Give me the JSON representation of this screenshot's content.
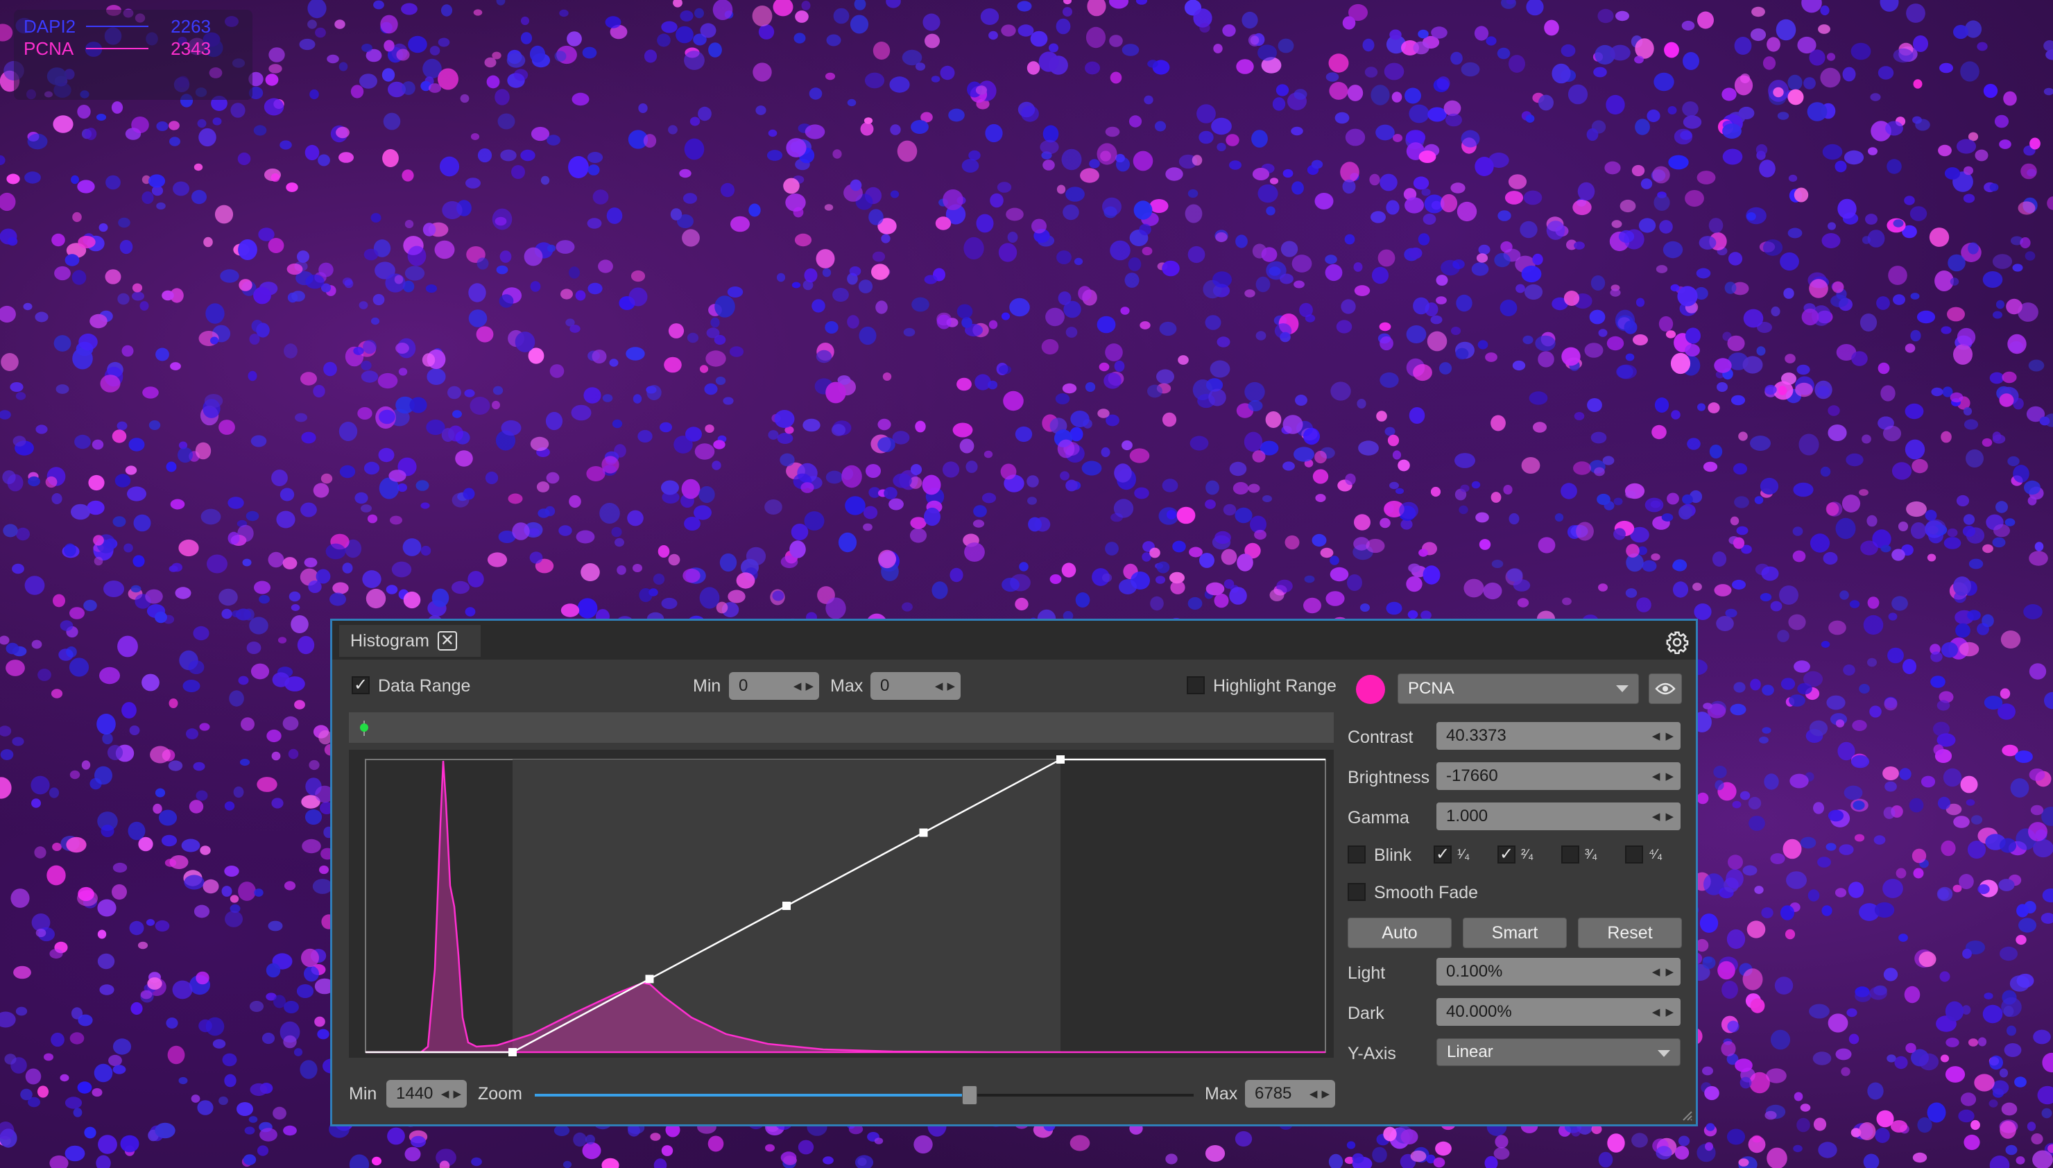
{
  "legend": {
    "channels": [
      {
        "name": "DAPI2",
        "value": "2263",
        "color": "#3b3bff"
      },
      {
        "name": "PCNA",
        "value": "2343",
        "color": "#ff2fd0"
      }
    ]
  },
  "panel": {
    "tab_label": "Histogram",
    "close_glyph": "✕",
    "data_range": {
      "label": "Data Range",
      "checked": true
    },
    "min_label": "Min",
    "min_value": "0",
    "max_label": "Max",
    "max_value": "0",
    "highlight_range": {
      "label": "Highlight Range",
      "checked": false
    },
    "range_marker_color": "#22dd44",
    "channel": {
      "color": "#ff1fb8",
      "selected": "PCNA"
    },
    "contrast": {
      "label": "Contrast",
      "value": "40.3373"
    },
    "brightness": {
      "label": "Brightness",
      "value": "-17660"
    },
    "gamma": {
      "label": "Gamma",
      "value": "1.000"
    },
    "blink": {
      "label": "Blink",
      "checked": false
    },
    "quarters": [
      {
        "label": "¹⁄₄",
        "checked": true
      },
      {
        "label": "²⁄₄",
        "checked": true
      },
      {
        "label": "³⁄₄",
        "checked": false
      },
      {
        "label": "⁴⁄₄",
        "checked": false
      }
    ],
    "smooth_fade": {
      "label": "Smooth Fade",
      "checked": false
    },
    "buttons": {
      "auto": "Auto",
      "smart": "Smart",
      "reset": "Reset"
    },
    "light": {
      "label": "Light",
      "value": "0.100%"
    },
    "dark": {
      "label": "Dark",
      "value": "40.000%"
    },
    "y_axis": {
      "label": "Y-Axis",
      "value": "Linear"
    },
    "bottom": {
      "min_label": "Min",
      "min_value": "1440",
      "zoom_label": "Zoom",
      "zoom_level": 0.66,
      "max_label": "Max",
      "max_value": "6785"
    },
    "accent_color": "#39a0e8",
    "histogram_color": "#ff2fd0"
  }
}
